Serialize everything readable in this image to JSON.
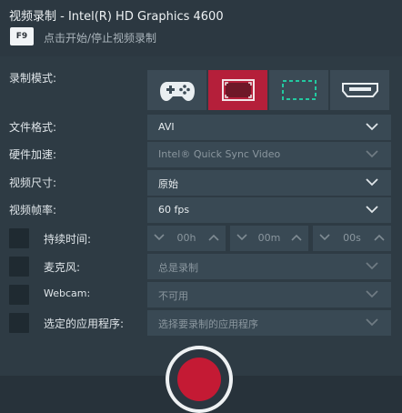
{
  "header": {
    "title": "视频录制 - Intel(R) HD Graphics 4600",
    "hotkey": "F9",
    "hint": "点击开始/停止视频录制"
  },
  "record_mode": {
    "label": "录制模式:",
    "modes": [
      {
        "icon": "gamepad-icon",
        "selected": false
      },
      {
        "icon": "fullscreen-icon",
        "selected": true
      },
      {
        "icon": "region-select-icon",
        "selected": false
      },
      {
        "icon": "hdmi-icon",
        "selected": false
      }
    ]
  },
  "file_format": {
    "label": "文件格式:",
    "value": "AVI"
  },
  "hw_accel": {
    "label": "硬件加速:",
    "value": "Intel® Quick Sync Video"
  },
  "video_size": {
    "label": "视频尺寸:",
    "value": "原始"
  },
  "frame_rate": {
    "label": "视频帧率:",
    "value": "60 fps"
  },
  "duration": {
    "label": "持续时间:",
    "checked": false,
    "hours": "00h",
    "minutes": "00m",
    "seconds": "00s"
  },
  "microphone": {
    "label": "麦克风:",
    "checked": false,
    "value": "总是录制"
  },
  "webcam": {
    "label": "Webcam:",
    "checked": false,
    "value": "不可用"
  },
  "selected_app": {
    "label": "选定的应用程序:",
    "checked": false,
    "value": "选择要录制的应用程序"
  },
  "colors": {
    "background": "#2e3b44",
    "panel": "#394954",
    "accent": "#b51f3a",
    "record": "#c41a34"
  }
}
